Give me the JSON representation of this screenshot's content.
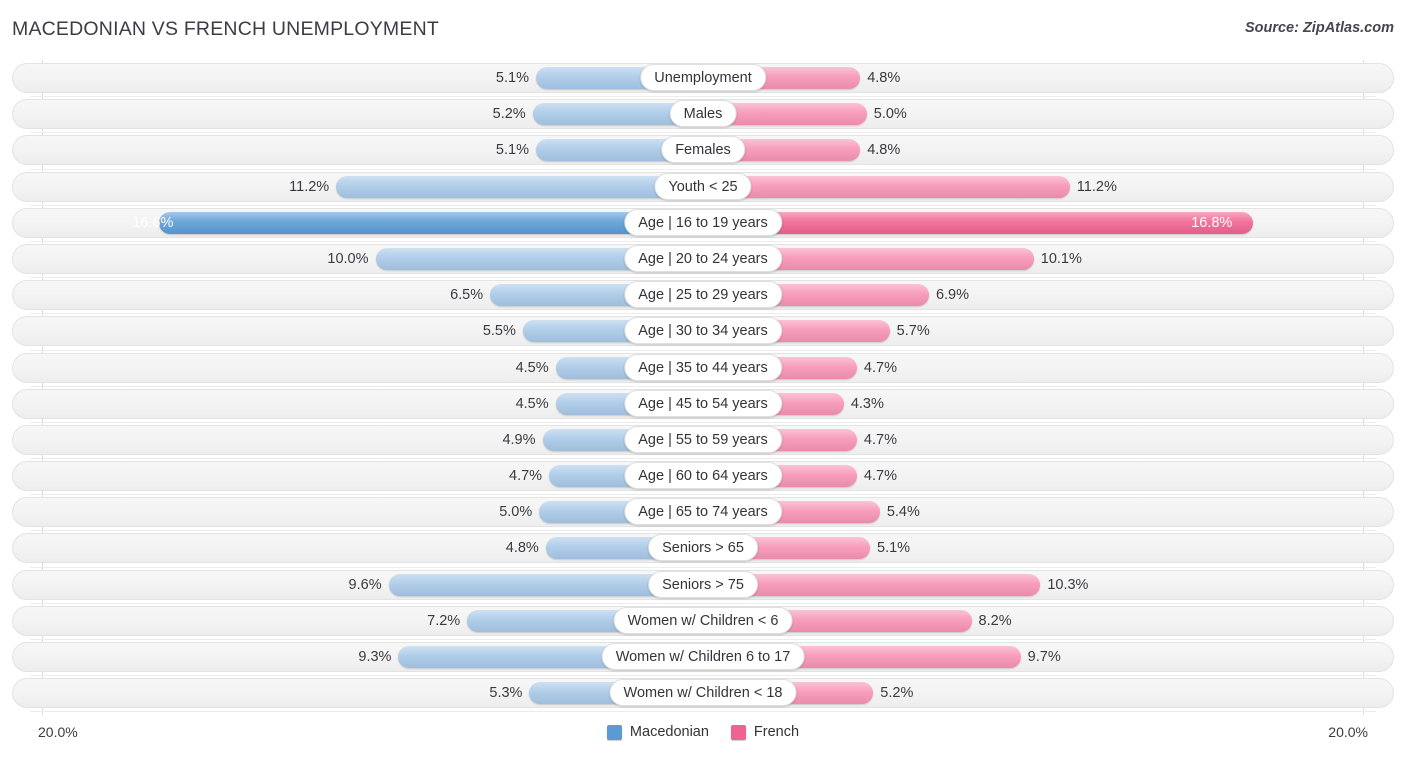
{
  "header": {
    "title": "MACEDONIAN VS FRENCH UNEMPLOYMENT",
    "source": "Source: ZipAtlas.com"
  },
  "legend": {
    "items": [
      {
        "label": "Macedonian",
        "color": "#5b9bd5"
      },
      {
        "label": "French",
        "color": "#f0628f"
      }
    ]
  },
  "axis": {
    "min_label": "20.0%",
    "max_label": "20.0%"
  },
  "colors": {
    "macedonian_light": "#a7c8e7",
    "macedonian_dark": "#5b9bd5",
    "french_light": "#f792b4",
    "french_dark": "#f0628f",
    "track": "#f3f3f3"
  },
  "chart_data": {
    "type": "bar",
    "title": "MACEDONIAN VS FRENCH UNEMPLOYMENT",
    "subtitle": "Source: ZipAtlas.com",
    "orientation": "horizontal-diverging",
    "xlabel": "",
    "ylabel": "",
    "xlim": [
      20.0,
      20.0
    ],
    "axis_max_percent": 20.0,
    "grid": false,
    "legend_position": "bottom-center",
    "categories": [
      "Unemployment",
      "Males",
      "Females",
      "Youth < 25",
      "Age | 16 to 19 years",
      "Age | 20 to 24 years",
      "Age | 25 to 29 years",
      "Age | 30 to 34 years",
      "Age | 35 to 44 years",
      "Age | 45 to 54 years",
      "Age | 55 to 59 years",
      "Age | 60 to 64 years",
      "Age | 65 to 74 years",
      "Seniors > 65",
      "Seniors > 75",
      "Women w/ Children < 6",
      "Women w/ Children 6 to 17",
      "Women w/ Children < 18"
    ],
    "series": [
      {
        "name": "Macedonian",
        "color": "#5b9bd5",
        "values": [
          5.1,
          5.2,
          5.1,
          11.2,
          16.6,
          10.0,
          6.5,
          5.5,
          4.5,
          4.5,
          4.9,
          4.7,
          5.0,
          4.8,
          9.6,
          7.2,
          9.3,
          5.3
        ],
        "labels": [
          "5.1%",
          "5.2%",
          "5.1%",
          "11.2%",
          "16.6%",
          "10.0%",
          "6.5%",
          "5.5%",
          "4.5%",
          "4.5%",
          "4.9%",
          "4.7%",
          "5.0%",
          "4.8%",
          "9.6%",
          "7.2%",
          "9.3%",
          "5.3%"
        ]
      },
      {
        "name": "French",
        "color": "#f0628f",
        "values": [
          4.8,
          5.0,
          4.8,
          11.2,
          16.8,
          10.1,
          6.9,
          5.7,
          4.7,
          4.3,
          4.7,
          4.7,
          5.4,
          5.1,
          10.3,
          8.2,
          9.7,
          5.2
        ],
        "labels": [
          "4.8%",
          "5.0%",
          "4.8%",
          "11.2%",
          "16.8%",
          "10.1%",
          "6.9%",
          "5.7%",
          "4.7%",
          "4.3%",
          "4.7%",
          "4.7%",
          "5.4%",
          "5.1%",
          "10.3%",
          "8.2%",
          "9.7%",
          "5.2%"
        ]
      }
    ],
    "highlighted_row": "Age | 16 to 19 years"
  }
}
